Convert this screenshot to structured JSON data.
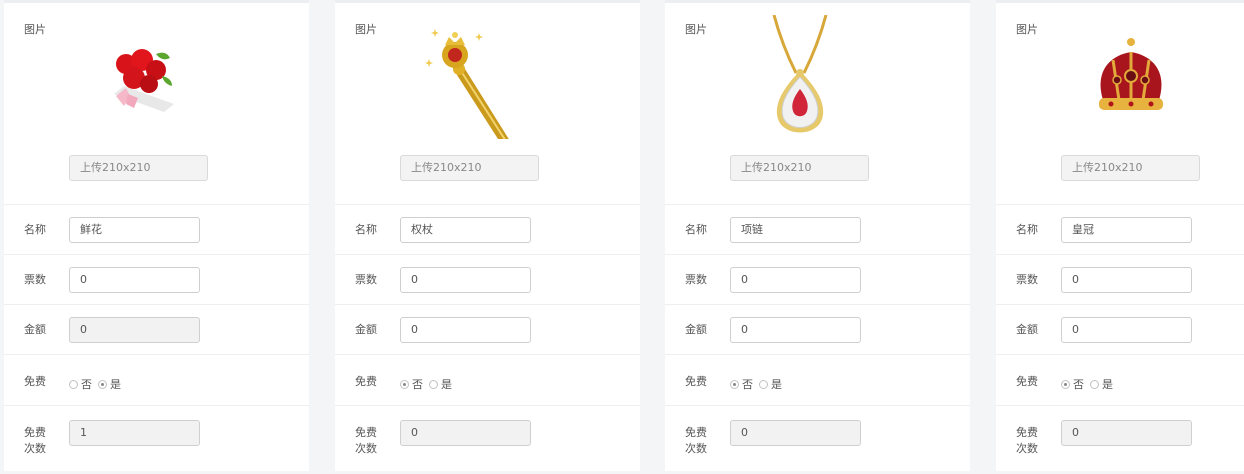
{
  "labels": {
    "image": "图片",
    "name": "名称",
    "votes": "票数",
    "amount": "金额",
    "free": "免费",
    "free_times_line1": "免费",
    "free_times_line2": "次数",
    "free_no": "否",
    "free_yes": "是",
    "upload": "上传210x210"
  },
  "gifts": [
    {
      "image_icon": "rose-bouquet-icon",
      "name": "鲜花",
      "votes": "0",
      "amount": "0",
      "free": "yes",
      "free_times": "1"
    },
    {
      "image_icon": "scepter-icon",
      "name": "权杖",
      "votes": "0",
      "amount": "0",
      "free": "no",
      "free_times": "0"
    },
    {
      "image_icon": "necklace-icon",
      "name": "项链",
      "votes": "0",
      "amount": "0",
      "free": "no",
      "free_times": "0"
    },
    {
      "image_icon": "crown-icon",
      "name": "皇冠",
      "votes": "0",
      "amount": "0",
      "free": "no",
      "free_times": "0"
    }
  ]
}
